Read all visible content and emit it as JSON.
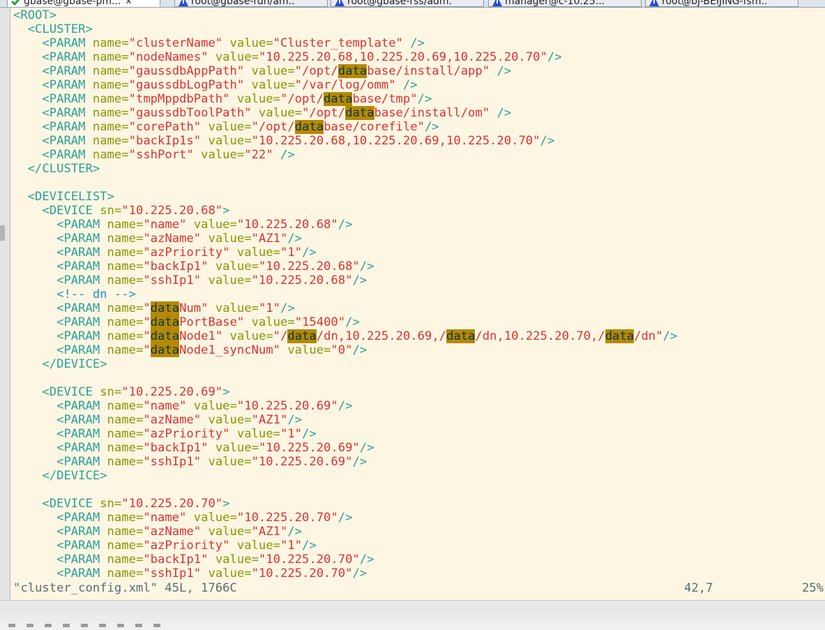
{
  "colors": {
    "background": "#fdf6e3",
    "tag": "#2aa198",
    "attr_name": "#859900",
    "attr_value": "#dc322f",
    "comment": "#268bd2",
    "search_highlight": "#b58900",
    "cursor": "#2aa198",
    "status_text": "#586e75"
  },
  "tabs": [
    {
      "label": "gbase@gbase-pm...",
      "icon": "check-icon",
      "active": true,
      "close": "✕"
    },
    {
      "label": "root@gbase-rdh/am...",
      "icon": "terminal-icon",
      "active": false
    },
    {
      "label": "root@gbase-rss/adm...",
      "icon": "terminal-icon",
      "active": false
    },
    {
      "label": "manager@c-10.25...",
      "icon": "terminal-icon",
      "active": false
    },
    {
      "label": "root@bj-BEIJING-fsm...",
      "icon": "terminal-icon",
      "active": false
    }
  ],
  "editor": {
    "search_term": "data",
    "cursor": {
      "line": 41,
      "col": 4
    },
    "lines": [
      "<ROOT>",
      "  <CLUSTER>",
      "    <PARAM name=\"clusterName\" value=\"Cluster_template\" />",
      "    <PARAM name=\"nodeNames\" value=\"10.225.20.68,10.225.20.69,10.225.20.70\"/>",
      "    <PARAM name=\"gaussdbAppPath\" value=\"/opt/database/install/app\" />",
      "    <PARAM name=\"gaussdbLogPath\" value=\"/var/log/omm\" />",
      "    <PARAM name=\"tmpMppdbPath\" value=\"/opt/database/tmp\"/>",
      "    <PARAM name=\"gaussdbToolPath\" value=\"/opt/database/install/om\" />",
      "    <PARAM name=\"corePath\" value=\"/opt/database/corefile\"/>",
      "    <PARAM name=\"backIp1s\" value=\"10.225.20.68,10.225.20.69,10.225.20.70\"/>",
      "    <PARAM name=\"sshPort\" value=\"22\" />",
      "  </CLUSTER>",
      "",
      "  <DEVICELIST>",
      "    <DEVICE sn=\"10.225.20.68\">",
      "      <PARAM name=\"name\" value=\"10.225.20.68\"/>",
      "      <PARAM name=\"azName\" value=\"AZ1\"/>",
      "      <PARAM name=\"azPriority\" value=\"1\"/>",
      "      <PARAM name=\"backIp1\" value=\"10.225.20.68\"/>",
      "      <PARAM name=\"sshIp1\" value=\"10.225.20.68\"/>",
      "      <!-- dn -->",
      "      <PARAM name=\"dataNum\" value=\"1\"/>",
      "      <PARAM name=\"dataPortBase\" value=\"15400\"/>",
      "      <PARAM name=\"dataNode1\" value=\"/data/dn,10.225.20.69,/data/dn,10.225.20.70,/data/dn\"/>",
      "      <PARAM name=\"dataNode1_syncNum\" value=\"0\"/>",
      "    </DEVICE>",
      "",
      "    <DEVICE sn=\"10.225.20.69\">",
      "      <PARAM name=\"name\" value=\"10.225.20.69\"/>",
      "      <PARAM name=\"azName\" value=\"AZ1\"/>",
      "      <PARAM name=\"azPriority\" value=\"1\"/>",
      "      <PARAM name=\"backIp1\" value=\"10.225.20.69\"/>",
      "      <PARAM name=\"sshIp1\" value=\"10.225.20.69\"/>",
      "    </DEVICE>",
      "",
      "    <DEVICE sn=\"10.225.20.70\">",
      "      <PARAM name=\"name\" value=\"10.225.20.70\"/>",
      "      <PARAM name=\"azName\" value=\"AZ1\"/>",
      "      <PARAM name=\"azPriority\" value=\"1\"/>",
      "      <PARAM name=\"backIp1\" value=\"10.225.20.70\"/>",
      "      <PARAM name=\"sshIp1\" value=\"10.225.20.70\"/>"
    ]
  },
  "status": {
    "file": "\"cluster_config.xml\" 45L, 1766C",
    "position": "42,7",
    "percent": "25%"
  }
}
